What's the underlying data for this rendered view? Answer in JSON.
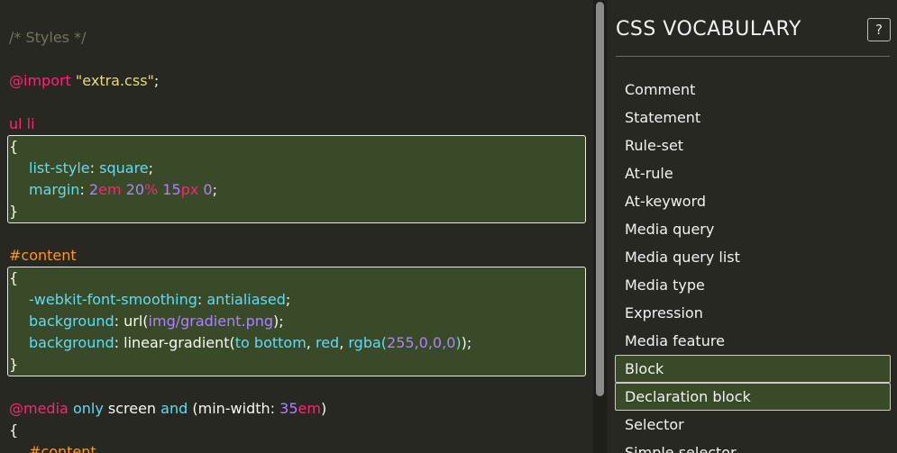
{
  "editor": {
    "comment": "/* Styles */",
    "import_keyword": "@import",
    "import_value": "\"extra.css\"",
    "import_semicolon": ";",
    "rule1": {
      "selector": "ul li",
      "open": "{",
      "close": "}",
      "decl1": {
        "prop": "list-style",
        "colon": ":",
        "value": "square",
        "end": ";"
      },
      "decl2": {
        "prop": "margin",
        "colon": ":",
        "v1n": "2",
        "v1u": "em",
        "v2n": "20",
        "v2u": "%",
        "v3n": "15",
        "v3u": "px",
        "v4n": "0",
        "end": ";"
      }
    },
    "rule2": {
      "selector": "#content",
      "open": "{",
      "close": "}",
      "decl1": {
        "prop": "-webkit-font-smoothing",
        "colon": ":",
        "value": "antialiased",
        "end": ";"
      },
      "decl2": {
        "prop": "background",
        "colon": ":",
        "fn": "url(",
        "arg": "img/gradient.png",
        "fn_close": ")",
        "end": ";"
      },
      "decl3": {
        "prop": "background",
        "colon": ":",
        "fn": "linear-gradient(",
        "a1": "to bottom",
        "comma1": ", ",
        "a2": "red",
        "comma2": ", ",
        "a3fn": "rgba(",
        "a3args": "255,0,0,0",
        "a3close": ")",
        "fn_close": ")",
        "end": ";"
      }
    },
    "media": {
      "keyword": "@media",
      "only": "only",
      "type": "screen",
      "and": "and",
      "expr_open": "(min-width:",
      "num": "35",
      "unit": "em",
      "expr_close": ")",
      "open": "{",
      "inner_selector": "#content"
    }
  },
  "panel": {
    "title": "CSS VOCABULARY",
    "help_label": "?",
    "items": [
      {
        "label": "Comment",
        "highlighted": false
      },
      {
        "label": "Statement",
        "highlighted": false
      },
      {
        "label": "Rule-set",
        "highlighted": false
      },
      {
        "label": "At-rule",
        "highlighted": false
      },
      {
        "label": "At-keyword",
        "highlighted": false
      },
      {
        "label": "Media query",
        "highlighted": false
      },
      {
        "label": "Media query list",
        "highlighted": false
      },
      {
        "label": "Media type",
        "highlighted": false
      },
      {
        "label": "Expression",
        "highlighted": false
      },
      {
        "label": "Media feature",
        "highlighted": false
      },
      {
        "label": "Block",
        "highlighted": true
      },
      {
        "label": "Declaration block",
        "highlighted": true
      },
      {
        "label": "Selector",
        "highlighted": false
      },
      {
        "label": "Simple selector",
        "highlighted": false
      }
    ]
  },
  "colors": {
    "background": "#272822",
    "highlight": "#384a28",
    "keyword": "#f92672",
    "string": "#e6db74",
    "property": "#66d9ef",
    "number": "#ae81ff",
    "id_selector": "#fd971f",
    "comment": "#75715e"
  }
}
